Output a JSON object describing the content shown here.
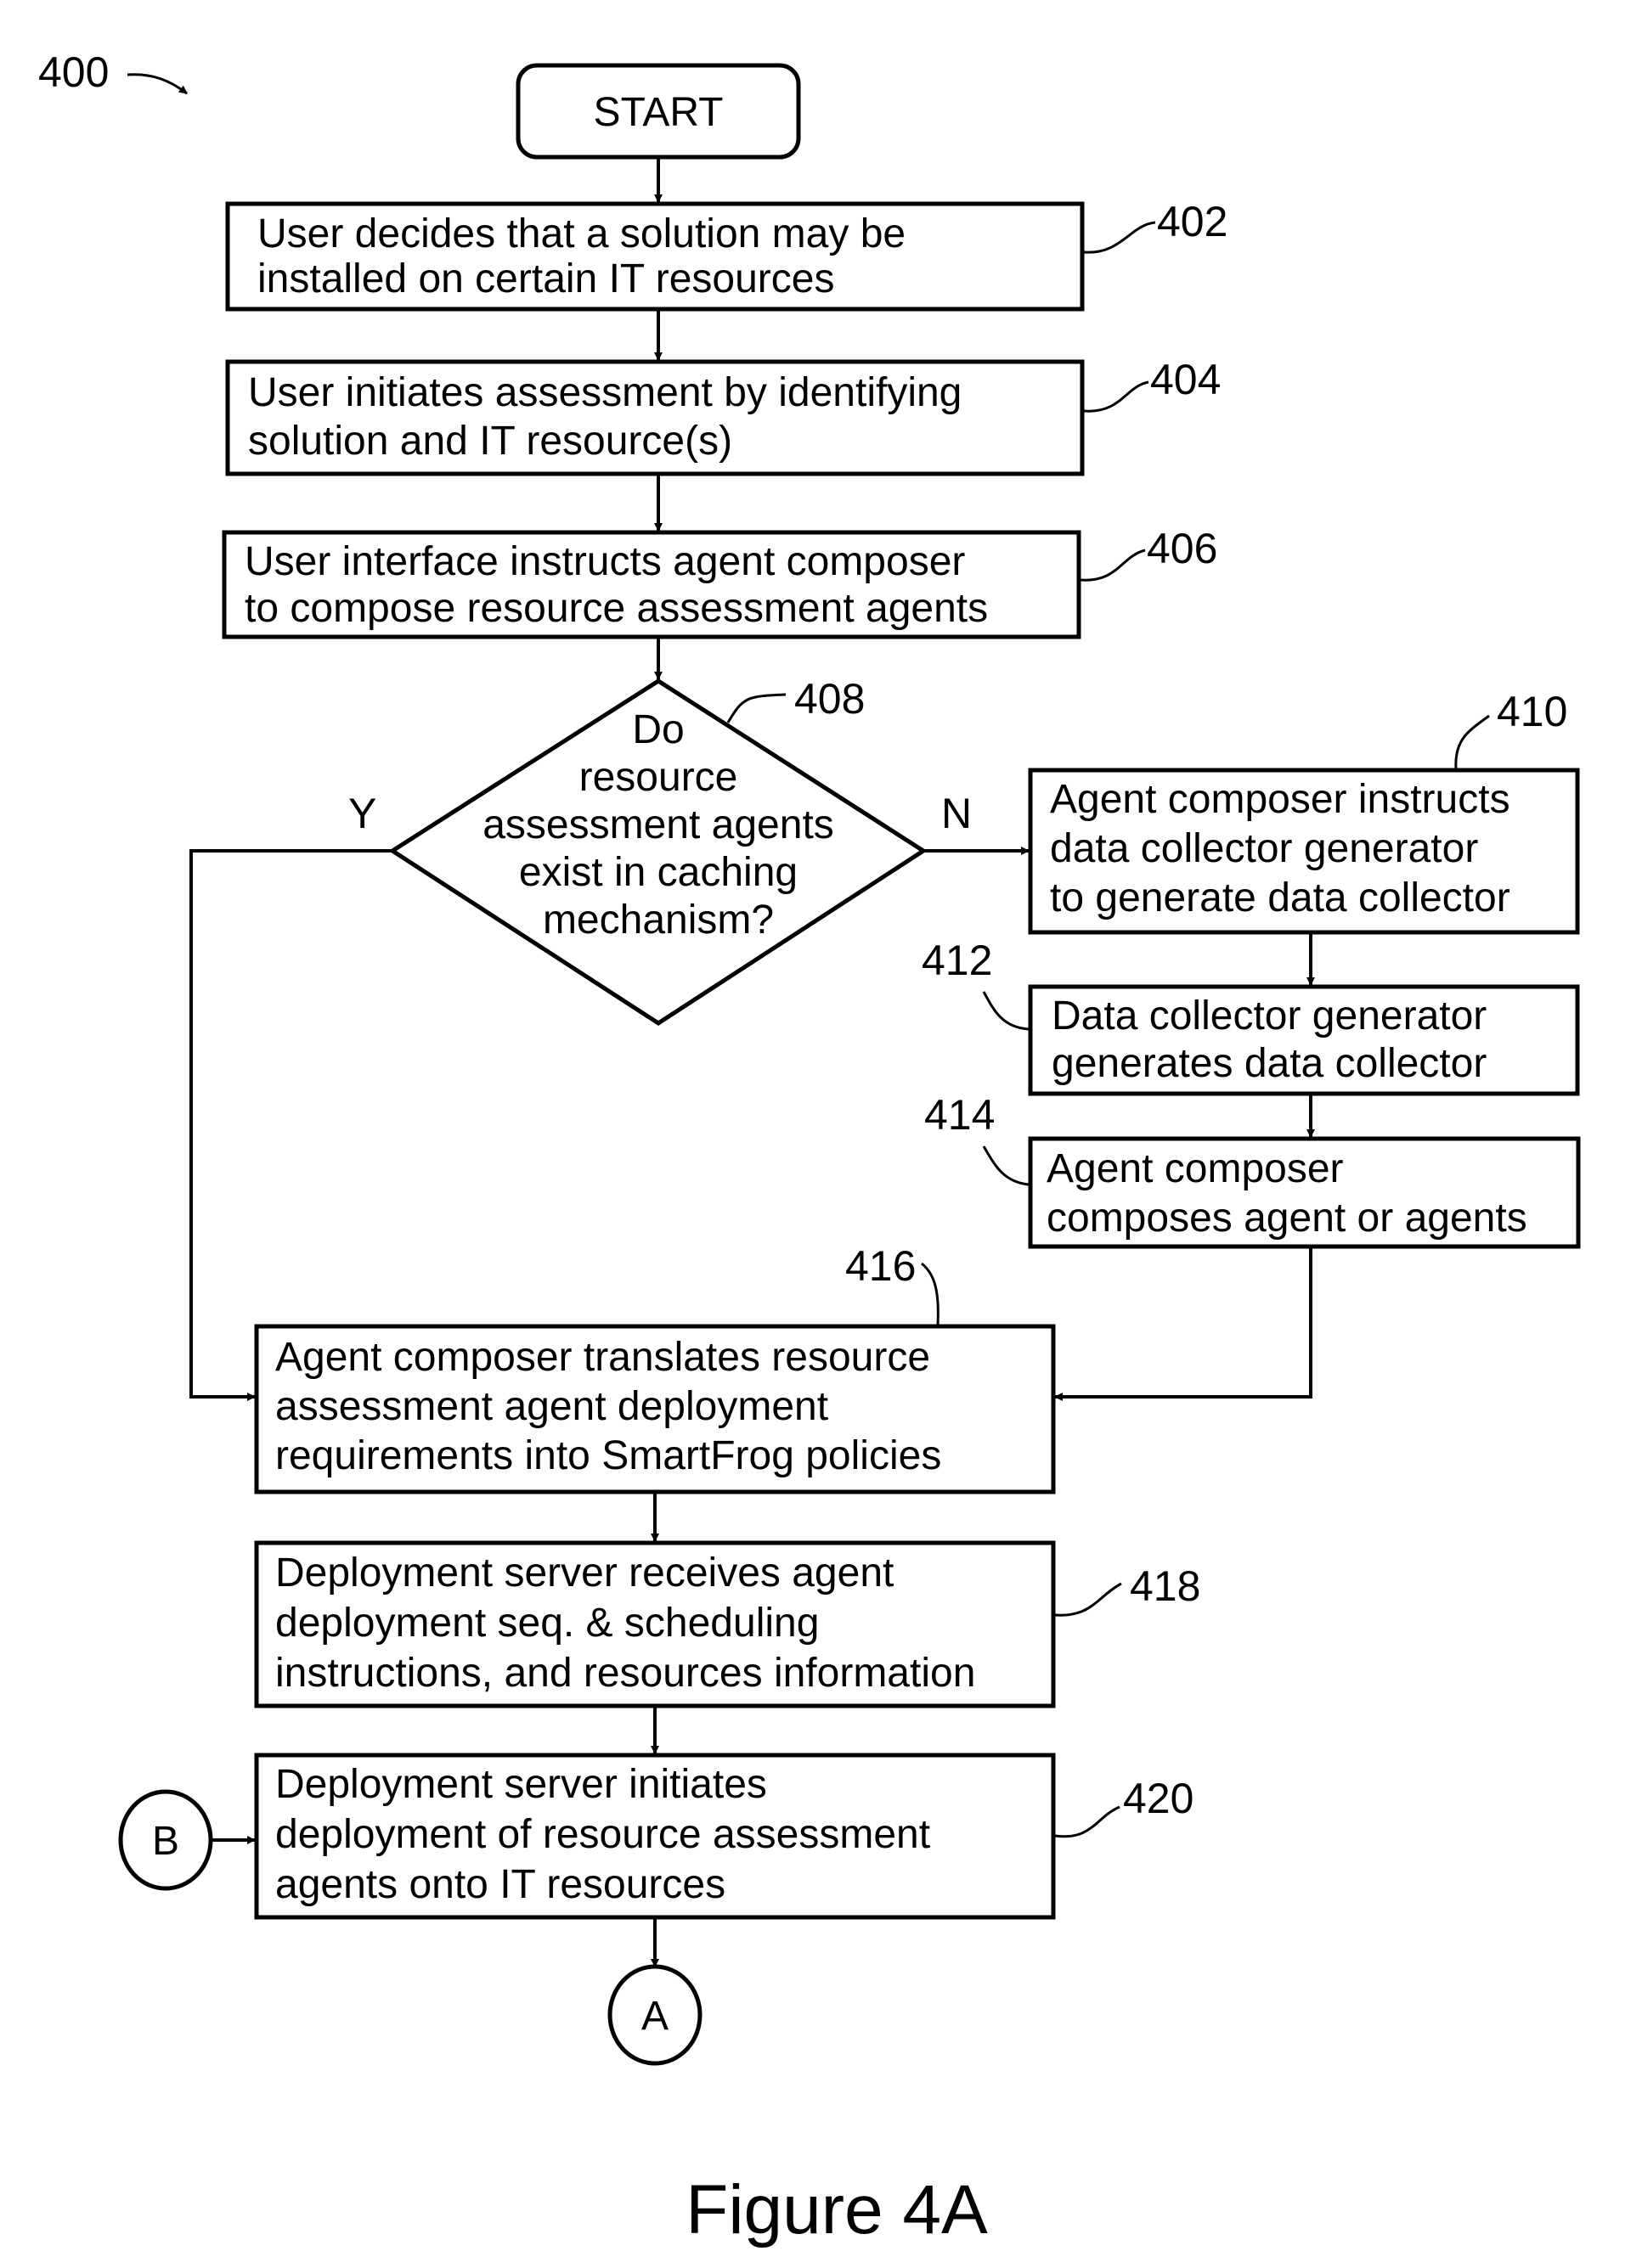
{
  "figure": {
    "reference": "400",
    "caption": "Figure 4A"
  },
  "nodes": {
    "start": {
      "label": "START"
    },
    "s402": {
      "ref": "402",
      "lines": [
        "User decides that a solution may be",
        "installed on certain IT resources"
      ]
    },
    "s404": {
      "ref": "404",
      "lines": [
        "User initiates assessment by identifying",
        "solution and IT resource(s)"
      ]
    },
    "s406": {
      "ref": "406",
      "lines": [
        "User interface instructs agent composer",
        "to compose resource assessment agents"
      ]
    },
    "d408": {
      "ref": "408",
      "lines": [
        "Do",
        "resource",
        "assessment agents",
        "exist in caching",
        "mechanism?"
      ],
      "yes_label": "Y",
      "no_label": "N"
    },
    "s410": {
      "ref": "410",
      "lines": [
        "Agent composer instructs",
        "data collector generator",
        "to generate data collector"
      ]
    },
    "s412": {
      "ref": "412",
      "lines": [
        "Data collector generator",
        "generates data collector"
      ]
    },
    "s414": {
      "ref": "414",
      "lines": [
        "Agent composer",
        "composes agent or agents"
      ]
    },
    "s416": {
      "ref": "416",
      "lines": [
        "Agent composer translates resource",
        "assessment agent deployment",
        "requirements into SmartFrog policies"
      ]
    },
    "s418": {
      "ref": "418",
      "lines": [
        "Deployment server receives agent",
        "deployment seq. & scheduling",
        "instructions, and resources information"
      ]
    },
    "s420": {
      "ref": "420",
      "lines": [
        "Deployment server initiates",
        "deployment of resource assessment",
        "agents onto IT resources"
      ]
    },
    "connector_b": {
      "label": "B"
    },
    "connector_a": {
      "label": "A"
    }
  }
}
